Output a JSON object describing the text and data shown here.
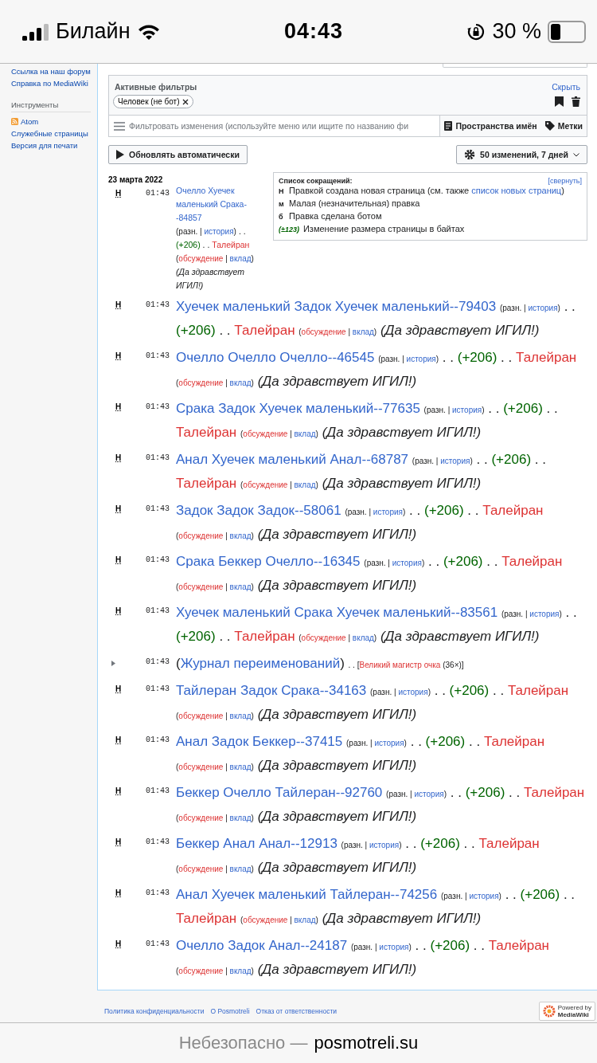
{
  "status_bar": {
    "carrier": "Билайн",
    "time": "04:43",
    "battery": "30 %"
  },
  "sidebar": {
    "links_top": [
      "Ссылка на наш форум",
      "Справка по MediaWiki"
    ],
    "sections": [
      {
        "heading": "Инструменты",
        "items": [
          {
            "label": "Atom",
            "kind": "feed"
          },
          {
            "label": "Служебные страницы",
            "kind": "link"
          },
          {
            "label": "Версия для печати",
            "kind": "link"
          }
        ]
      }
    ]
  },
  "filters": {
    "title": "Активные фильтры",
    "hide": "Скрыть",
    "chips": [
      "Человек (не бот)"
    ],
    "placeholder": "Фильтровать изменения (используйте меню или ищите по названию фи",
    "namespaces": "Пространства имён",
    "tags": "Метки"
  },
  "live_update": "Обновлять автоматически",
  "options": "50 изменений, 7 дней",
  "date": "23 марта 2022",
  "legend": {
    "title": "Список сокращений:",
    "collapse": "[свернуть]",
    "items": [
      {
        "mark": "Н",
        "text": "Правкой создана новая страница (см. также ",
        "link": "список новых страниц",
        "after": ")"
      },
      {
        "mark": "м",
        "text": "Малая (незначительная) правка"
      },
      {
        "mark": "б",
        "text": "Правка сделана ботом"
      },
      {
        "mark": "(±123)",
        "text": "Изменение размера страницы в байтах",
        "kind": "size"
      }
    ]
  },
  "marks": {
    "open": "(",
    "close": ")",
    "bar": "|",
    "dots": ". .",
    "lbracket": "[",
    "rbracket": "]"
  },
  "changes": [
    {
      "kind": "edit",
      "flag": "Н",
      "time": "01:43",
      "title": "Очелло Хуечек маленький Срака--84857",
      "diff": "разн.",
      "history": "история",
      "size": "+206",
      "user": "Талейран",
      "talk": "обсуждение",
      "contribs": "вклад",
      "summary": "Да здравствует ИГИЛ!"
    },
    {
      "kind": "edit",
      "flag": "Н",
      "time": "01:43",
      "title": "Хуечек маленький Задок Хуечек маленький--79403",
      "diff": "разн.",
      "history": "история",
      "size": "+206",
      "user": "Талейран",
      "talk": "обсуждение",
      "contribs": "вклад",
      "summary": "Да здравствует ИГИЛ!"
    },
    {
      "kind": "edit",
      "flag": "Н",
      "time": "01:43",
      "title": "Очелло Очелло Очелло--46545",
      "diff": "разн.",
      "history": "история",
      "size": "+206",
      "user": "Талейран",
      "talk": "обсуждение",
      "contribs": "вклад",
      "summary": "Да здравствует ИГИЛ!"
    },
    {
      "kind": "edit",
      "flag": "Н",
      "time": "01:43",
      "title": "Срака Задок Хуечек маленький--77635",
      "diff": "разн.",
      "history": "история",
      "size": "+206",
      "user": "Талейран",
      "talk": "обсуждение",
      "contribs": "вклад",
      "summary": "Да здравствует ИГИЛ!"
    },
    {
      "kind": "edit",
      "flag": "Н",
      "time": "01:43",
      "title": "Анал Хуечек маленький Анал--68787",
      "diff": "разн.",
      "history": "история",
      "size": "+206",
      "user": "Талейран",
      "talk": "обсуждение",
      "contribs": "вклад",
      "summary": "Да здравствует ИГИЛ!"
    },
    {
      "kind": "edit",
      "flag": "Н",
      "time": "01:43",
      "title": "Задок Задок Задок--58061",
      "diff": "разн.",
      "history": "история",
      "size": "+206",
      "user": "Талейран",
      "talk": "обсуждение",
      "contribs": "вклад",
      "summary": "Да здравствует ИГИЛ!"
    },
    {
      "kind": "edit",
      "flag": "Н",
      "time": "01:43",
      "title": "Срака Беккер Очелло--16345",
      "diff": "разн.",
      "history": "история",
      "size": "+206",
      "user": "Талейран",
      "talk": "обсуждение",
      "contribs": "вклад",
      "summary": "Да здравствует ИГИЛ!"
    },
    {
      "kind": "edit",
      "flag": "Н",
      "time": "01:43",
      "title": "Хуечек маленький Срака Хуечек маленький--83561",
      "diff": "разн.",
      "history": "история",
      "size": "+206",
      "user": "Талейран",
      "talk": "обсуждение",
      "contribs": "вклад",
      "summary": "Да здравствует ИГИЛ!"
    },
    {
      "kind": "log",
      "time": "01:43",
      "title": "Журнал переименований",
      "user": "Великий магистр очка",
      "count": "36×"
    },
    {
      "kind": "edit",
      "flag": "Н",
      "time": "01:43",
      "title": "Тайлеран Задок Срака--34163",
      "diff": "разн.",
      "history": "история",
      "size": "+206",
      "user": "Талейран",
      "talk": "обсуждение",
      "contribs": "вклад",
      "summary": "Да здравствует ИГИЛ!"
    },
    {
      "kind": "edit",
      "flag": "Н",
      "time": "01:43",
      "title": "Анал Задок Беккер--37415",
      "diff": "разн.",
      "history": "история",
      "size": "+206",
      "user": "Талейран",
      "talk": "обсуждение",
      "contribs": "вклад",
      "summary": "Да здравствует ИГИЛ!"
    },
    {
      "kind": "edit",
      "flag": "Н",
      "time": "01:43",
      "title": "Беккер Очелло Тайлеран--92760",
      "diff": "разн.",
      "history": "история",
      "size": "+206",
      "user": "Талейран",
      "talk": "обсуждение",
      "contribs": "вклад",
      "summary": "Да здравствует ИГИЛ!"
    },
    {
      "kind": "edit",
      "flag": "Н",
      "time": "01:43",
      "title": "Беккер Анал Анал--12913",
      "diff": "разн.",
      "history": "история",
      "size": "+206",
      "user": "Талейран",
      "talk": "обсуждение",
      "contribs": "вклад",
      "summary": "Да здравствует ИГИЛ!"
    },
    {
      "kind": "edit",
      "flag": "Н",
      "time": "01:43",
      "title": "Анал Хуечек маленький Тайлеран--74256",
      "diff": "разн.",
      "history": "история",
      "size": "+206",
      "user": "Талейран",
      "talk": "обсуждение",
      "contribs": "вклад",
      "summary": "Да здравствует ИГИЛ!"
    },
    {
      "kind": "edit",
      "flag": "Н",
      "time": "01:43",
      "title": "Очелло Задок Анал--24187",
      "diff": "разн.",
      "history": "история",
      "size": "+206",
      "user": "Талейран",
      "talk": "обсуждение",
      "contribs": "вклад",
      "summary": "Да здравствует ИГИЛ!"
    }
  ],
  "footer": {
    "links": [
      "Политика конфиденциальности",
      "О Posmotreli",
      "Отказ от ответственности"
    ],
    "badge_top": "Powered by",
    "badge_bottom": "MediaWiki"
  },
  "address_bar": {
    "security": "Небезопасно —",
    "domain": "posmotreli.su"
  }
}
